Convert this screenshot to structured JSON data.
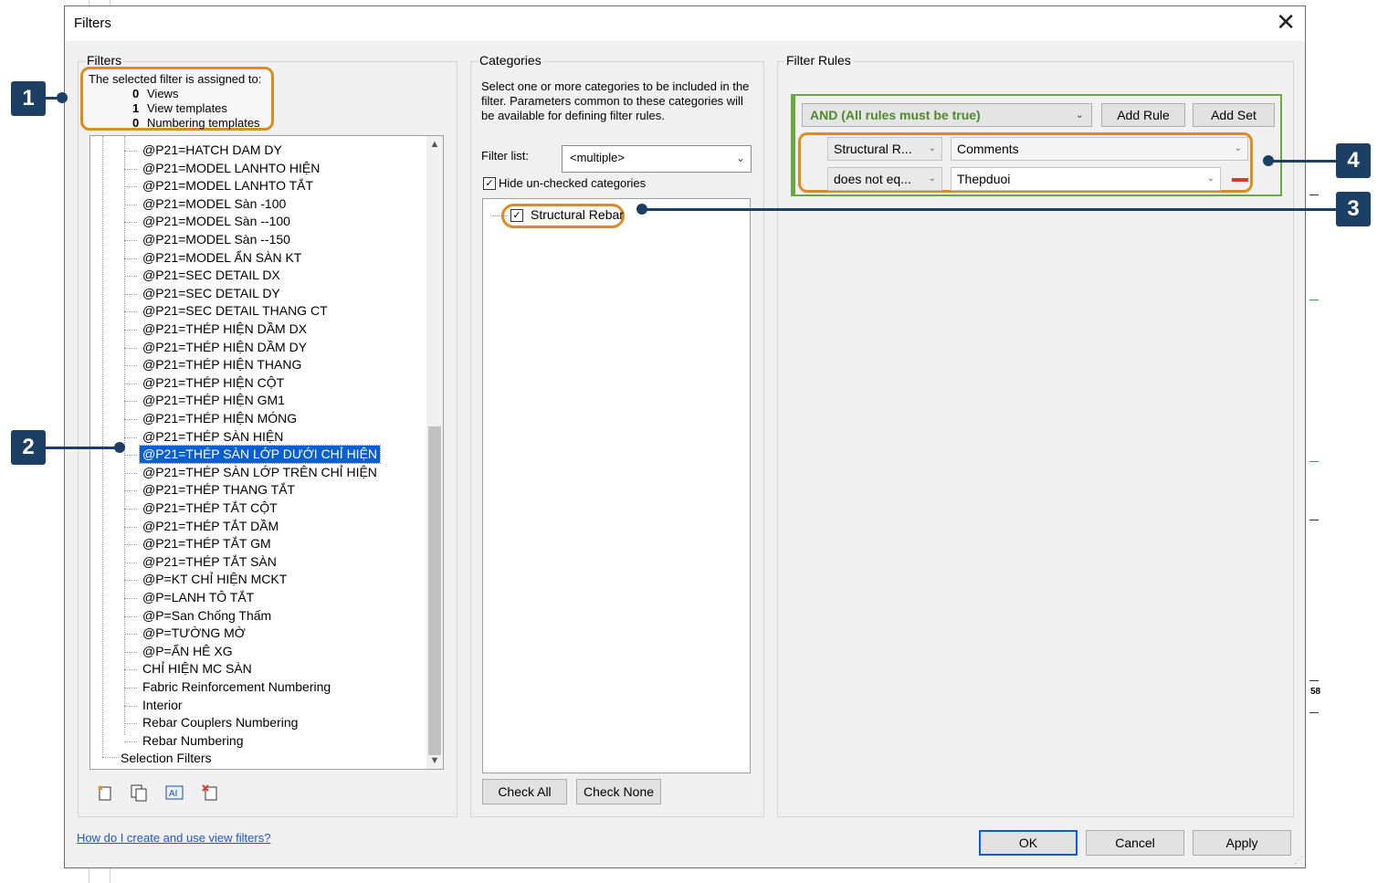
{
  "dialog": {
    "title": "Filters",
    "close": "✕"
  },
  "filters_group": {
    "label": "Filters",
    "assigned": {
      "header": "The selected filter is assigned to:",
      "rows": [
        {
          "count": "0",
          "label": "Views"
        },
        {
          "count": "1",
          "label": "View templates"
        },
        {
          "count": "0",
          "label": "Numbering templates"
        }
      ]
    },
    "tree_items": [
      "@P21=HATCH DAM DY",
      "@P21=MODEL LANHTO HIỆN",
      "@P21=MODEL LANHTO TẮT",
      "@P21=MODEL Sàn -100",
      "@P21=MODEL Sàn --100",
      "@P21=MODEL Sàn --150",
      "@P21=MODEL ẨN SÀN KT",
      "@P21=SEC DETAIL DX",
      "@P21=SEC DETAIL DY",
      "@P21=SEC DETAIL THANG CT",
      "@P21=THÉP  HIỆN  DẦM DX",
      "@P21=THÉP HIỆN  DẦM DY",
      "@P21=THÉP HIỆN  THANG",
      "@P21=THÉP HIỆN CỘT",
      "@P21=THÉP HIỆN GM1",
      "@P21=THÉP HIỆN MÓNG",
      "@P21=THÉP SÀN HIỆN",
      "@P21=THÉP SÀN LỚP DƯỚI CHỈ HIỆN",
      "@P21=THÉP SÀN LỚP TRÊN CHỈ HIỆN",
      "@P21=THÉP THANG TẮT",
      "@P21=THÉP TẮT  CỘT",
      "@P21=THÉP TẮT  DẦM",
      "@P21=THÉP TẮT GM",
      "@P21=THÉP TẮT SÀN",
      "@P=KT CHỈ HIỆN MCKT",
      "@P=LANH TÔ TẮT",
      "@P=San Chống Thấm",
      "@P=TƯỜNG MỜ",
      "@P=ẨN HÊ XG",
      "CHỈ HIỆN MC SÀN",
      "Fabric Reinforcement Numbering",
      "Interior",
      "Rebar Couplers Numbering",
      "Rebar Numbering"
    ],
    "selected_index": 17,
    "root_item": "Selection Filters"
  },
  "categories_group": {
    "label": "Categories",
    "description": "Select one or more categories to be included in the filter.  Parameters common to these categories will be available for defining filter rules.",
    "filter_list_label": "Filter list:",
    "filter_list_value": "<multiple>",
    "hide_unchecked_label": "Hide un-checked categories",
    "hide_unchecked": true,
    "items": [
      {
        "label": "Structural Rebar",
        "checked": true
      }
    ],
    "check_all": "Check All",
    "check_none": "Check None"
  },
  "rules_group": {
    "label": "Filter Rules",
    "logic": "AND (All rules must be true)",
    "add_rule": "Add Rule",
    "add_set": "Add Set",
    "rule": {
      "category": "Structural R...",
      "parameter": "Comments",
      "operator": "does not eq...",
      "value": "Thepduoi"
    }
  },
  "footer": {
    "help_link": "How do I create and use view filters?",
    "ok": "OK",
    "cancel": "Cancel",
    "apply": "Apply"
  },
  "callouts": {
    "c1": "1",
    "c2": "2",
    "c3": "3",
    "c4": "4"
  },
  "background_text": "58",
  "colors": {
    "callout": "#1d3f66",
    "highlight_oval": "#d98c22",
    "rules_border": "#6aa842",
    "selection": "#0a5fd0",
    "logic_text": "#4f8a2a"
  }
}
